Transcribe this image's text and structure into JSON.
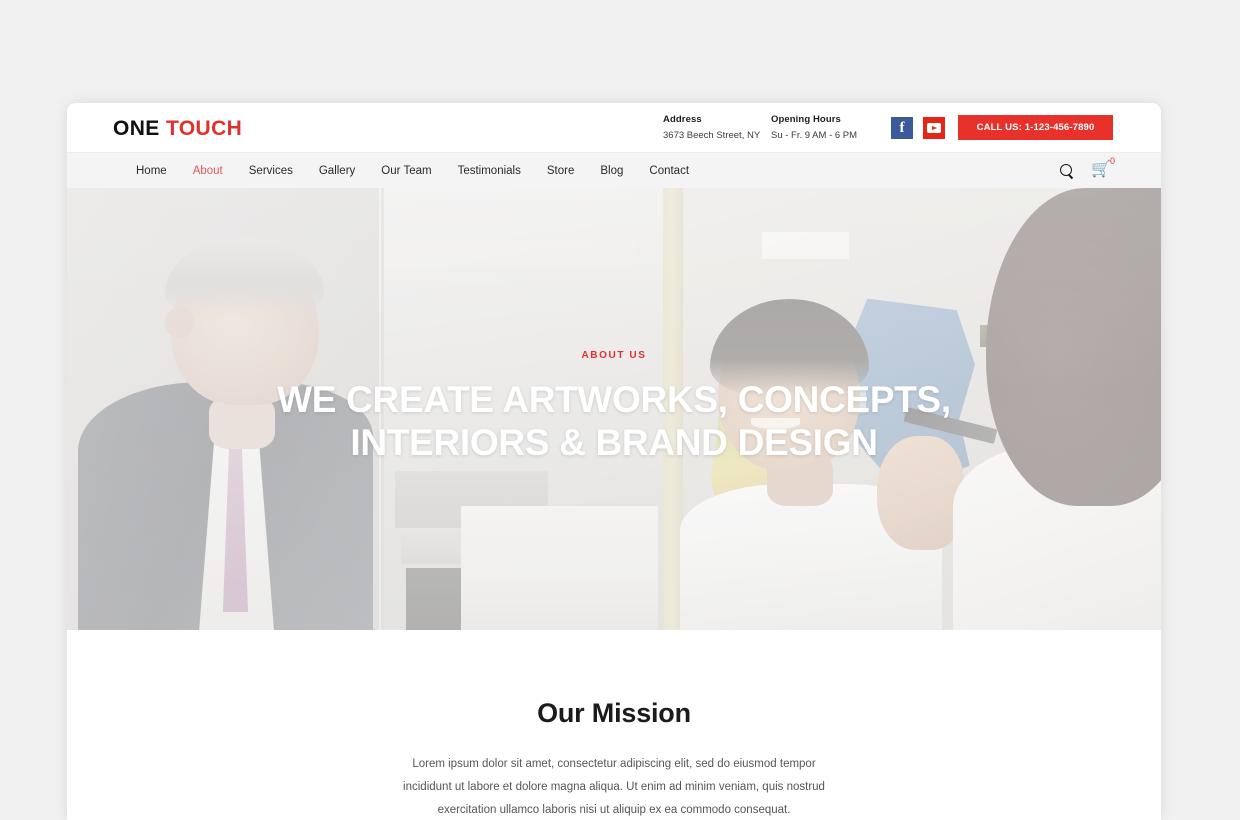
{
  "page": {
    "background_color": "#f1f1f1",
    "accent_color": "#e8312b",
    "nav_active_color": "#e2585b"
  },
  "header": {
    "logo": {
      "first": "ONE",
      "second": "TOUCH"
    },
    "address": {
      "title": "Address",
      "value": "3673 Beech Street, NY"
    },
    "hours": {
      "title": "Opening Hours",
      "value": "Su - Fr. 9 AM - 6 PM"
    },
    "social": [
      {
        "name": "facebook-icon",
        "glyph": "f",
        "color": "#3c5a9a"
      },
      {
        "name": "youtube-icon",
        "glyph": "▶",
        "color": "#e32717"
      }
    ],
    "call_button": "CALL US: 1-123-456-7890"
  },
  "nav": {
    "items": [
      {
        "label": "Home",
        "active": false
      },
      {
        "label": "About",
        "active": true
      },
      {
        "label": "Services",
        "active": false
      },
      {
        "label": "Gallery",
        "active": false
      },
      {
        "label": "Our Team",
        "active": false
      },
      {
        "label": "Testimonials",
        "active": false
      },
      {
        "label": "Store",
        "active": false
      },
      {
        "label": "Blog",
        "active": false
      },
      {
        "label": "Contact",
        "active": false
      }
    ],
    "search_icon": "search-icon",
    "cart_icon": "shopping-cart-icon",
    "cart_glyph": "🛒",
    "cart_count": "0"
  },
  "hero": {
    "kicker": "ABOUT US",
    "title_line1": "WE CREATE ARTWORKS, CONCEPTS,",
    "title_line2": "INTERIORS & BRAND DESIGN",
    "image_description": "office meeting, businessman in suit at left, colleague in white shirt smiling, maps on wall"
  },
  "mission": {
    "title": "Our Mission",
    "paragraph": "Lorem ipsum dolor sit amet, consectetur adipiscing elit, sed do eiusmod tempor incididunt ut labore et dolore magna aliqua. Ut enim ad minim veniam, quis nostrud exercitation ullamco laboris nisi ut aliquip ex ea commodo consequat."
  }
}
